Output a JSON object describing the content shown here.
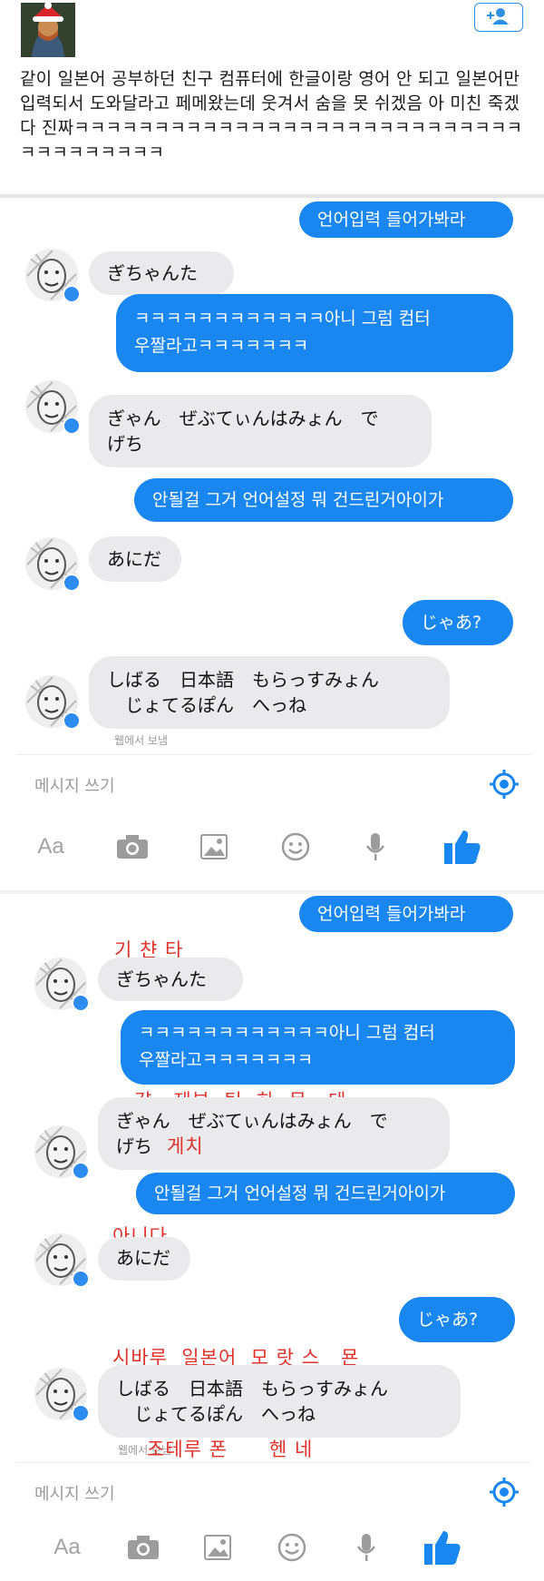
{
  "post": {
    "text": "같이 일본어 공부하던 친구 컴퓨터에 한글이랑 영어 안 되고 일본어만 입력되서 도와달라고 페메왔는데 웃겨서 숨을 못 쉬겠음 아 미친 죽겠다 진짜ㅋㅋㅋㅋㅋㅋㅋㅋㅋㅋㅋㅋㅋㅋㅋㅋㅋㅋㅋㅋㅋㅋㅋㅋㅋㅋㅋㅋㅋㅋㅋㅋㅋㅋㅋㅋㅋ",
    "follow_icon": "add-person-icon"
  },
  "messages": {
    "m1": "언어입력 들어가봐라",
    "m2": "ぎちゃんた",
    "m3a": "ㅋㅋㅋㅋㅋㅋㅋㅋㅋㅋㅋㅋ아니 그럼 컴터",
    "m3b": "우짤라고ㅋㅋㅋㅋㅋㅋㅋ",
    "m4a": "ぎゃん　ぜぶてぃんはみょん　で",
    "m4b": "げち",
    "m5": "안될걸 그거 언어설정 뭐 건드린거아이가",
    "m6": "あにだ",
    "m7": "じゃあ?",
    "m8a": "しばる　日本語　もらっすみょん",
    "m8b": "じょてるぽん　へっね",
    "sent_via": "웹에서 보냄"
  },
  "composer": {
    "placeholder": "메시지 쓰기",
    "aa_label": "Aa"
  },
  "annotations": {
    "a2": "기 챤 타",
    "a4": "걍   제부  팅  하  묜   데",
    "a4b": "게치",
    "a6": "아니다",
    "a8": "시바루  일본어  모 랏 스   묜",
    "a8b": "조테루 폰      헨 네"
  },
  "colors": {
    "accent": "#1a86f0",
    "incoming_bubble": "#eaeaec",
    "annotation": "#e0312b"
  }
}
